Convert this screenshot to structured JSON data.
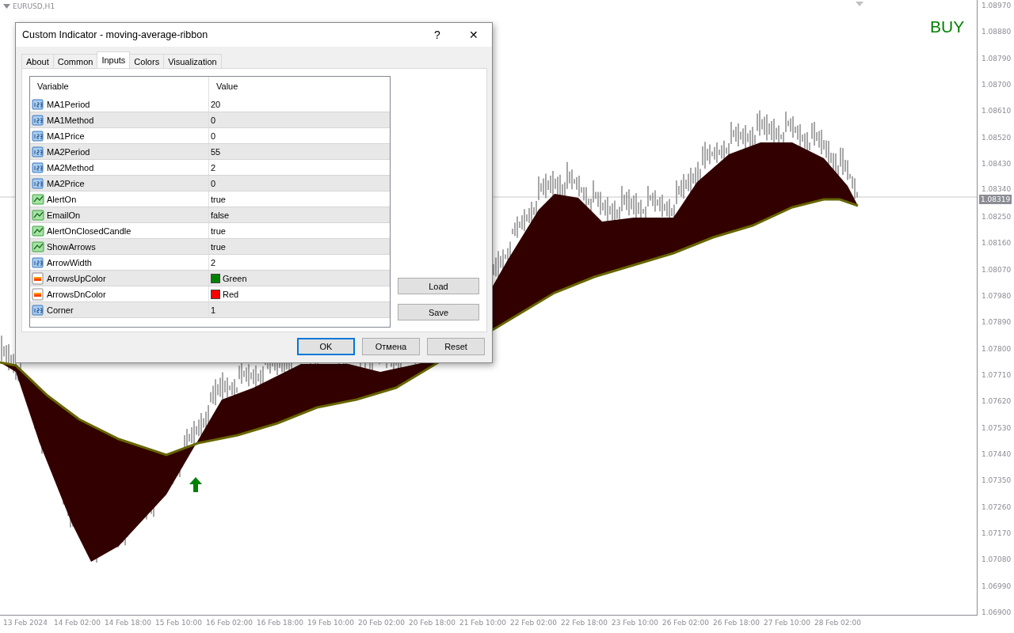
{
  "chart": {
    "symbol": "EURUSD,H1",
    "signal": "BUY",
    "price_axis": [
      "1.08970",
      "1.08880",
      "1.08790",
      "1.08700",
      "1.08610",
      "1.08520",
      "1.08430",
      "1.08340",
      "1.08250",
      "1.08160",
      "1.08070",
      "1.07980",
      "1.07890",
      "1.07800",
      "1.07710",
      "1.07620",
      "1.07530",
      "1.07440",
      "1.07350",
      "1.07260",
      "1.07170",
      "1.07080",
      "1.06990",
      "1.06900"
    ],
    "current_price": "1.08319",
    "time_axis": [
      "13 Feb 2024",
      "14 Feb 02:00",
      "14 Feb 18:00",
      "15 Feb 10:00",
      "16 Feb 02:00",
      "16 Feb 18:00",
      "19 Feb 10:00",
      "20 Feb 02:00",
      "20 Feb 18:00",
      "21 Feb 10:00",
      "22 Feb 02:00",
      "22 Feb 18:00",
      "23 Feb 10:00",
      "26 Feb 02:00",
      "26 Feb 18:00",
      "27 Feb 10:00",
      "28 Feb 02:00"
    ]
  },
  "dialog": {
    "title": "Custom Indicator - moving-average-ribbon",
    "help": "?",
    "close": "✕",
    "tabs": [
      {
        "label": "About",
        "selected": false
      },
      {
        "label": "Common",
        "selected": false
      },
      {
        "label": "Inputs",
        "selected": true
      },
      {
        "label": "Colors",
        "selected": false
      },
      {
        "label": "Visualization",
        "selected": false
      }
    ],
    "table": {
      "columns": [
        "Variable",
        "Value"
      ],
      "rows": [
        {
          "kind": "int",
          "variable": "MA1Period",
          "value": "20"
        },
        {
          "kind": "int",
          "variable": "MA1Method",
          "value": "0"
        },
        {
          "kind": "int",
          "variable": "MA1Price",
          "value": "0"
        },
        {
          "kind": "int",
          "variable": "MA2Period",
          "value": "55"
        },
        {
          "kind": "int",
          "variable": "MA2Method",
          "value": "2"
        },
        {
          "kind": "int",
          "variable": "MA2Price",
          "value": "0"
        },
        {
          "kind": "bool",
          "variable": "AlertOn",
          "value": "true"
        },
        {
          "kind": "bool",
          "variable": "EmailOn",
          "value": "false"
        },
        {
          "kind": "bool",
          "variable": "AlertOnClosedCandle",
          "value": "true"
        },
        {
          "kind": "bool",
          "variable": "ShowArrows",
          "value": "true"
        },
        {
          "kind": "int",
          "variable": "ArrowWidth",
          "value": "2"
        },
        {
          "kind": "color",
          "variable": "ArrowsUpColor",
          "value": "Green",
          "color": "#008000"
        },
        {
          "kind": "color",
          "variable": "ArrowsDnColor",
          "value": "Red",
          "color": "#ff0000"
        },
        {
          "kind": "int",
          "variable": "Corner",
          "value": "1"
        }
      ]
    },
    "side_buttons": [
      "Load",
      "Save"
    ],
    "buttons": [
      {
        "label": "OK",
        "default": true
      },
      {
        "label": "Отмена",
        "default": false
      },
      {
        "label": "Reset",
        "default": false
      }
    ]
  }
}
